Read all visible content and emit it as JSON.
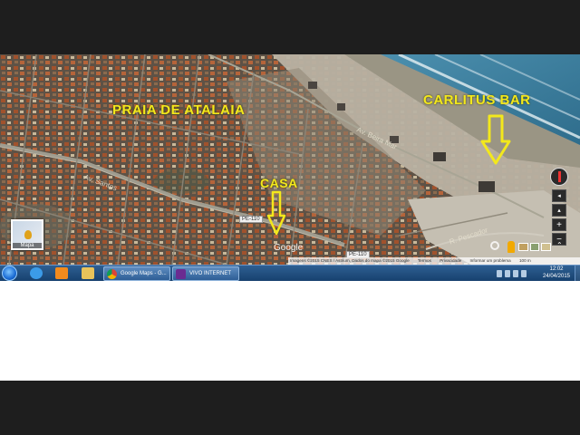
{
  "map": {
    "labels": {
      "praia": "PRAIA DE ATALAIA",
      "carlitus": "CARLITUS BAR",
      "casa": "CASA"
    },
    "road_labels": {
      "main_road": "Av. Santos",
      "beach_road": "Av. Beira Mar",
      "route_1": "PE-110",
      "route_2": "PE-110",
      "lower_road": "R. Pescador"
    },
    "google_logo": "Google",
    "mapa_thumbnail_label": "Mapa",
    "attribution": {
      "imagery": "Imagens ©2015 CNES / Astrium, Dados do mapa ©2015 Google",
      "terms": "Termos",
      "privacy": "Privacidade",
      "report": "Informar um problema",
      "scale": "100 m"
    },
    "colors": {
      "label_yellow": "#f3e81c",
      "ocean": "#3f7f9c",
      "sand": "#b9b2a3",
      "urban": "#6b5e50"
    }
  },
  "taskbar": {
    "tasks": [
      {
        "label": "Google Maps - G...",
        "icon": "chrome-icon"
      },
      {
        "label": "VIVO INTERNET",
        "icon": "vivo-icon"
      }
    ],
    "clock": {
      "time": "12:02",
      "date": "24/04/2015"
    }
  }
}
